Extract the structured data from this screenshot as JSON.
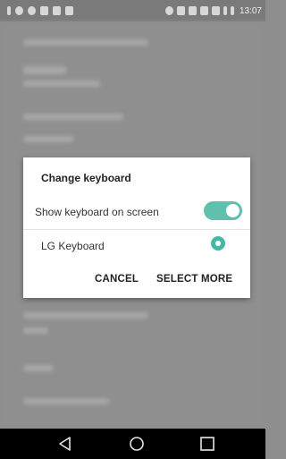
{
  "status_bar": {
    "time": "13:07",
    "left_icons": [
      "battery-icon",
      "notification-icon",
      "notification-icon",
      "image-icon",
      "notification-icon",
      "usb-icon"
    ],
    "right_icons": [
      "alarm-icon",
      "nfc-icon",
      "vibrate-icon",
      "location-icon",
      "wifi-icon",
      "signal-icon",
      "battery-icon"
    ]
  },
  "dialog": {
    "title": "Change keyboard",
    "show_keyboard_label": "Show keyboard on screen",
    "show_keyboard_on": true,
    "keyboard_option_label": "LG Keyboard",
    "keyboard_selected": true,
    "cancel_label": "CANCEL",
    "select_more_label": "SELECT MORE"
  },
  "nav_bar": {
    "buttons": [
      "back-icon",
      "home-icon",
      "recents-icon"
    ]
  },
  "colors": {
    "accent": "#5fc0ad",
    "scrim": "#8e8e8e",
    "dialog_bg": "#ffffff",
    "nav_bg": "#000000"
  }
}
